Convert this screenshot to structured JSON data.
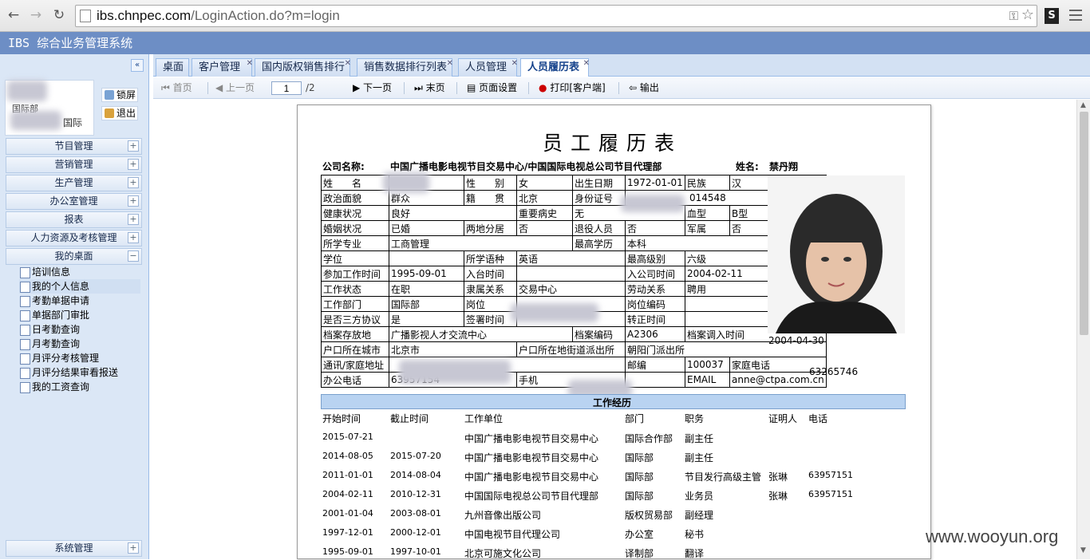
{
  "browser": {
    "url_host": "ibs.chnpec.com",
    "url_path": "/LoginAction.do?m=login",
    "ext_icon": "S"
  },
  "app": {
    "title": "IBS 综合业务管理系统"
  },
  "sidebar": {
    "collapse": "«",
    "user_dept1": "国际部",
    "user_dept2": "国际",
    "lock": "锁屏",
    "logout": "退出",
    "menus": [
      {
        "label": "节目管理",
        "sign": "+"
      },
      {
        "label": "营销管理",
        "sign": "+"
      },
      {
        "label": "生产管理",
        "sign": "+"
      },
      {
        "label": "办公室管理",
        "sign": "+"
      },
      {
        "label": "报表",
        "sign": "+"
      },
      {
        "label": "人力资源及考核管理",
        "sign": "+"
      },
      {
        "label": "我的桌面",
        "sign": "−"
      }
    ],
    "items": [
      "培训信息",
      "我的个人信息",
      "考勤单据申请",
      "单据部门审批",
      "日考勤查询",
      "月考勤查询",
      "月评分考核管理",
      "月评分结果审看报送",
      "我的工资查询"
    ],
    "bottom": {
      "label": "系统管理",
      "sign": "+"
    }
  },
  "tabs": [
    "桌面",
    "客户管理",
    "国内版权销售排行",
    "销售数据排行列表",
    "人员管理",
    "人员履历表"
  ],
  "toolbar": {
    "first": "首页",
    "prev": "上一页",
    "page": "1",
    "total": "/2",
    "next": "下一页",
    "last": "末页",
    "setup": "页面设置",
    "print": "打印[客户端]",
    "export": "输出"
  },
  "doc": {
    "title": "员工履历表",
    "company_label": "公司名称:",
    "company": "中国广播电影电视节目交易中心/中国国际电视总公司节目代理部",
    "name_label": "姓名:",
    "name": "禁丹翔",
    "rows": {
      "r1": [
        "姓　　名",
        "",
        "性　　别",
        "女",
        "出生日期",
        "1972-01-01",
        "民族",
        "汉"
      ],
      "r2": [
        "政治面貌",
        "群众",
        "籍　　贯",
        "北京",
        "身份证号",
        "014548"
      ],
      "r3": [
        "健康状况",
        "良好",
        "重要病史",
        "无",
        "血型",
        "B型"
      ],
      "r4": [
        "婚姻状况",
        "已婚",
        "两地分居",
        "否",
        "退役人员",
        "否",
        "军属",
        "否"
      ],
      "r5": [
        "所学专业",
        "工商管理",
        "最高学历",
        "本科"
      ],
      "r6": [
        "学位",
        "",
        "所学语种",
        "英语",
        "最高级别",
        "六级"
      ],
      "r7": [
        "参加工作时间",
        "1995-09-01",
        "入台时间",
        "",
        "入公司时间",
        "2004-02-11"
      ],
      "r8": [
        "工作状态",
        "在职",
        "隶属关系",
        "交易中心",
        "劳动关系",
        "聘用"
      ],
      "r9": [
        "工作部门",
        "国际部",
        "岗位",
        "",
        "岗位编码",
        ""
      ],
      "r10": [
        "是否三方协议",
        "是",
        "签署时间",
        "",
        "转正时间",
        ""
      ],
      "r11": [
        "档案存放地",
        "广播影视人才交流中心",
        "档案编码",
        "A2306",
        "档案调入时间",
        "2004-04-30"
      ],
      "r12": [
        "户口所在城市",
        "北京市",
        "户口所在地街道派出所",
        "朝阳门派出所"
      ],
      "r13": [
        "通讯/家庭地址",
        "",
        "邮编",
        "100037",
        "家庭电话",
        "63265746"
      ],
      "r14": [
        "办公电话",
        "63957154",
        "手机",
        "",
        "EMAIL",
        "anne@ctpa.com.cn"
      ]
    },
    "work_title": "工作经历",
    "work_headers": [
      "开始时间",
      "截止时间",
      "工作单位",
      "部门",
      "职务",
      "证明人",
      "电话"
    ],
    "work": [
      [
        "2015-07-21",
        "",
        "中国广播电影电视节目交易中心",
        "国际合作部",
        "副主任",
        "",
        ""
      ],
      [
        "2014-08-05",
        "2015-07-20",
        "中国广播电影电视节目交易中心",
        "国际部",
        "副主任",
        "",
        ""
      ],
      [
        "2011-01-01",
        "2014-08-04",
        "中国广播电影电视节目交易中心",
        "国际部",
        "节目发行高级主管",
        "张琳",
        "63957151"
      ],
      [
        "2004-02-11",
        "2010-12-31",
        "中国国际电视总公司节目代理部",
        "国际部",
        "业务员",
        "张琳",
        "63957151"
      ],
      [
        "2001-01-04",
        "2003-08-01",
        "九州音像出版公司",
        "版权贸易部",
        "副经理",
        "",
        ""
      ],
      [
        "1997-12-01",
        "2000-12-01",
        "中国电视节目代理公司",
        "办公室",
        "秘书",
        "",
        ""
      ],
      [
        "1995-09-01",
        "1997-10-01",
        "北京可施文化公司",
        "译制部",
        "翻译",
        "",
        ""
      ]
    ]
  },
  "watermark": "www.wooyun.org"
}
